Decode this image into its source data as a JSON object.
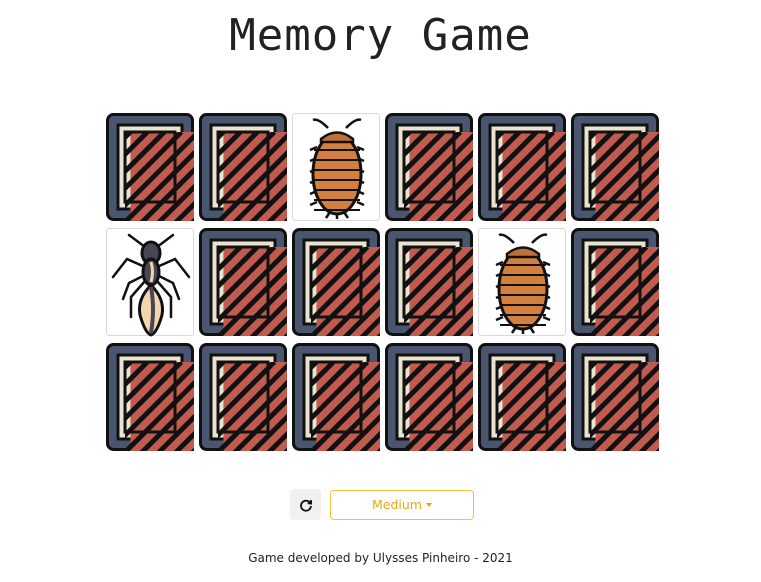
{
  "title": "Memory Game",
  "board": {
    "columns": 6,
    "rows": 3,
    "cards": [
      {
        "state": "down"
      },
      {
        "state": "down"
      },
      {
        "state": "up",
        "image": "isopod-icon"
      },
      {
        "state": "down"
      },
      {
        "state": "down"
      },
      {
        "state": "down"
      },
      {
        "state": "up",
        "image": "ant-icon"
      },
      {
        "state": "down"
      },
      {
        "state": "down"
      },
      {
        "state": "down"
      },
      {
        "state": "up",
        "image": "isopod-icon"
      },
      {
        "state": "down"
      },
      {
        "state": "down"
      },
      {
        "state": "down"
      },
      {
        "state": "down"
      },
      {
        "state": "down"
      },
      {
        "state": "down"
      },
      {
        "state": "down"
      }
    ]
  },
  "controls": {
    "reset_icon": "refresh-icon",
    "difficulty_label": "Medium"
  },
  "footer": "Game developed by Ulysses Pinheiro - 2021",
  "colors": {
    "card_back_frame": "#4a5570",
    "card_back_panel": "#c15b50",
    "card_back_border": "#e9e4d2",
    "accent": "#f3c13a"
  }
}
